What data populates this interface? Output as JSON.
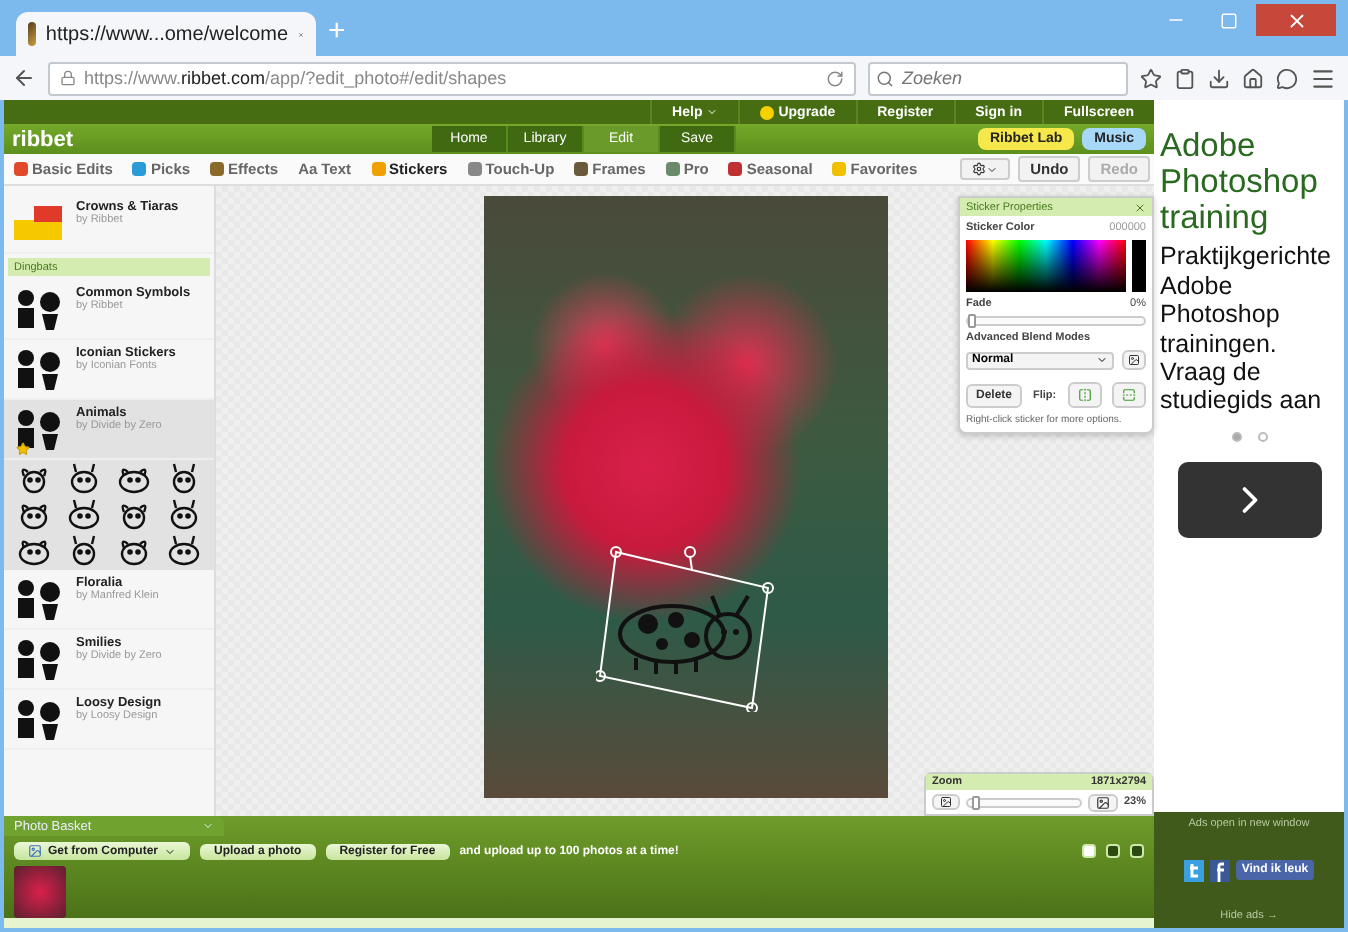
{
  "browser": {
    "tab_title": "https://www...ome/welcome",
    "new_tab": "+",
    "url_prefix": "https://www.",
    "url_domain": "ribbet.com",
    "url_path": "/app/?edit_photo#/edit/shapes",
    "search": {
      "placeholder": "Zoeken"
    }
  },
  "app": {
    "logo": "ribbet",
    "top_links": [
      {
        "label": "Help",
        "kind": "menu"
      },
      {
        "label": "Upgrade",
        "kind": "coin"
      },
      {
        "label": "Register",
        "kind": "plain"
      },
      {
        "label": "Sign in",
        "kind": "plain"
      },
      {
        "label": "Fullscreen",
        "kind": "plain"
      }
    ],
    "main_tabs": [
      {
        "label": "Home",
        "selected": false
      },
      {
        "label": "Library",
        "selected": false
      },
      {
        "label": "Edit",
        "selected": true
      },
      {
        "label": "Save",
        "selected": false
      }
    ],
    "lab_button": "Ribbet Lab",
    "music_button": "Music",
    "tools": [
      {
        "label": "Basic Edits",
        "selected": false
      },
      {
        "label": "Picks",
        "selected": false
      },
      {
        "label": "Effects",
        "selected": false
      },
      {
        "label": "Text",
        "selected": false,
        "prefix": "Aa"
      },
      {
        "label": "Stickers",
        "selected": true
      },
      {
        "label": "Touch-Up",
        "selected": false
      },
      {
        "label": "Frames",
        "selected": false
      },
      {
        "label": "Pro",
        "selected": false
      },
      {
        "label": "Seasonal",
        "selected": false
      },
      {
        "label": "Favorites",
        "selected": false
      }
    ],
    "undo": {
      "label": "Undo",
      "disabled": false
    },
    "redo": {
      "label": "Redo",
      "disabled": true
    },
    "sidebar": [
      {
        "kind": "pack",
        "name": "Crowns & Tiaras",
        "author": "by Ribbet",
        "expanded": false,
        "favorite": false
      },
      {
        "kind": "header",
        "label": "Dingbats"
      },
      {
        "kind": "pack",
        "name": "Common Symbols",
        "author": "by Ribbet",
        "expanded": false,
        "favorite": false
      },
      {
        "kind": "pack",
        "name": "Iconian Stickers",
        "author": "by Iconian Fonts",
        "expanded": false,
        "favorite": false
      },
      {
        "kind": "pack",
        "name": "Animals",
        "author": "by Divide by Zero",
        "expanded": true,
        "favorite": true
      },
      {
        "kind": "pack",
        "name": "Floralia",
        "author": "by Manfred Klein",
        "expanded": false,
        "favorite": false
      },
      {
        "kind": "pack",
        "name": "Smilies",
        "author": "by Divide by Zero",
        "expanded": false,
        "favorite": false
      },
      {
        "kind": "pack",
        "name": "Loosy Design",
        "author": "by Loosy Design",
        "expanded": false,
        "favorite": false
      }
    ],
    "sticker_properties": {
      "title": "Sticker Properties",
      "color_label": "Sticker Color",
      "color_value": "000000",
      "color": "#000000",
      "fade_label": "Fade",
      "fade": {
        "level": 0.0,
        "reading": "0%"
      },
      "blend_label": "Advanced Blend Modes",
      "blend_mode": "Normal",
      "delete": "Delete",
      "flip_label": "Flip:",
      "hint": "Right-click sticker for more options."
    },
    "zoom": {
      "label": "Zoom",
      "size": "1871x2794",
      "level": 0.03,
      "reading": "23%"
    },
    "photo_basket": {
      "title": "Photo Basket",
      "source": "Get from Computer",
      "upload": "Upload a photo",
      "register": "Register for Free",
      "note": "and upload up to 100 photos at a time!",
      "views": [
        {
          "selected": true
        },
        {
          "selected": false
        },
        {
          "selected": false
        }
      ]
    }
  },
  "ad": {
    "headline": "Adobe Photoshop training",
    "body": "Praktijkgerichte Adobe Photoshop trainingen. Vraag de studiegids aan",
    "dots": [
      {
        "selected": true
      },
      {
        "selected": false
      }
    ],
    "notice": "Ads open in new window",
    "like": "Vind ik leuk",
    "hide": "Hide ads →"
  }
}
